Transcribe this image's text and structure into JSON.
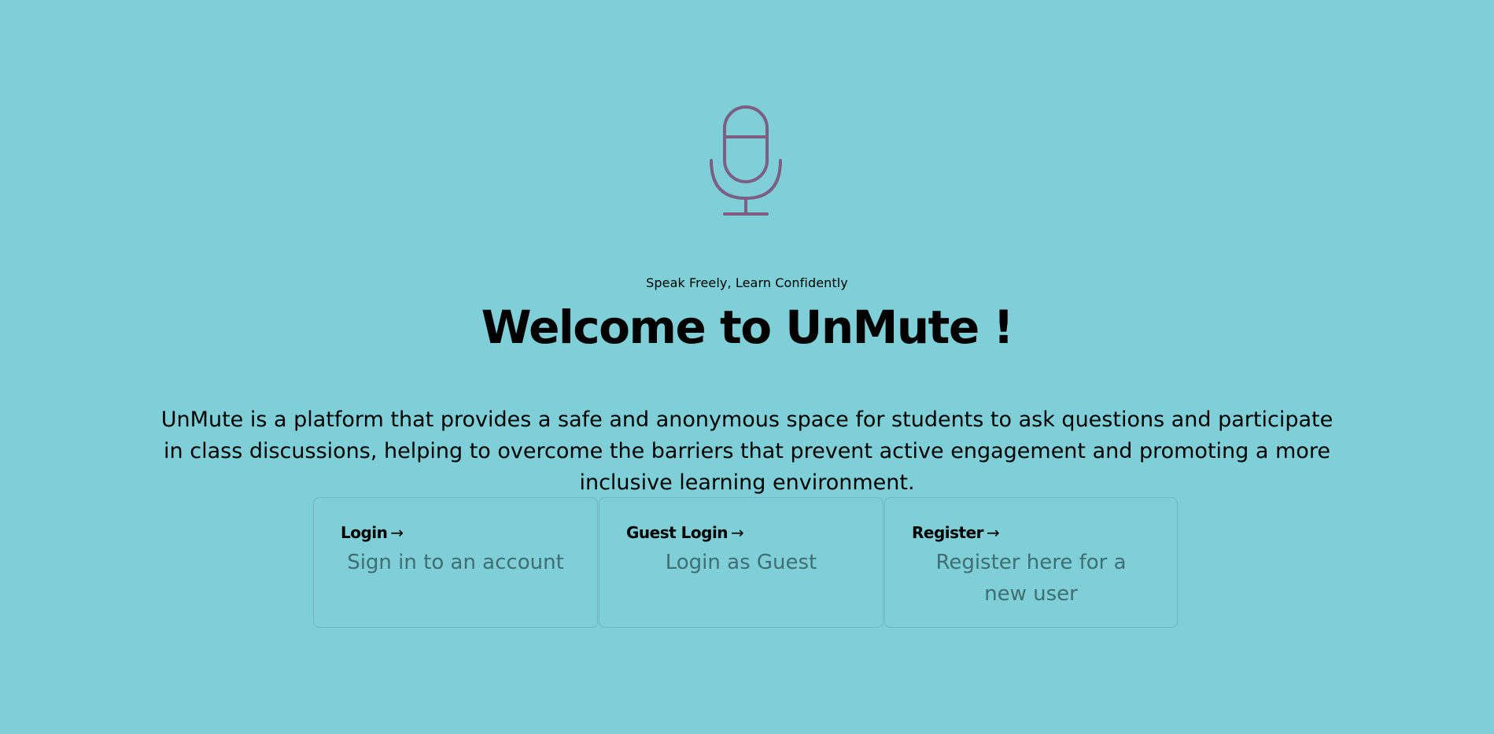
{
  "hero": {
    "icon": "microphone-icon",
    "icon_color": "#7d5f84",
    "tagline": "Speak Freely, Learn Confidently",
    "title": "Welcome to UnMute !",
    "description": "UnMute is a platform that provides a safe and anonymous space for students to ask questions and participate in class discussions, helping to overcome the barriers that prevent active engagement and promoting a more inclusive learning environment."
  },
  "cards": [
    {
      "title": "Login",
      "arrow": "→",
      "description": "Sign in to an account"
    },
    {
      "title": "Guest Login",
      "arrow": "→",
      "description": "Login as Guest"
    },
    {
      "title": "Register",
      "arrow": "→",
      "description": "Register here for a new user"
    }
  ],
  "colors": {
    "background": "#7ecfd7",
    "text": "#000000",
    "card_description": "#3f6e73",
    "card_border": "#6fb8bf"
  }
}
